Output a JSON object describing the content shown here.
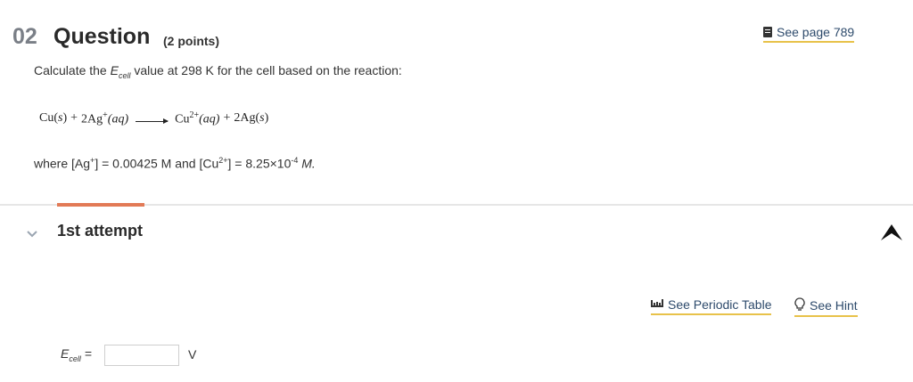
{
  "question": {
    "number": "02",
    "title": "Question",
    "points": "(2 points)",
    "see_page": "See page 789",
    "prompt_before": "Calculate the ",
    "prompt_e": "E",
    "prompt_sub": "cell",
    "prompt_after": " value at 298 K for the cell based on the reaction:"
  },
  "reaction": {
    "r1": "Cu(",
    "r1_state": "s",
    "r1_close": ")",
    "plus1": "+",
    "r2": "2Ag",
    "r2_sup": "+",
    "r2_state": "(aq)",
    "p1": "Cu",
    "p1_sup": "2+",
    "p1_state": "(aq)",
    "plus2": "+",
    "p2": "2Ag(",
    "p2_state": "s",
    "p2_close": ")"
  },
  "conditions": {
    "where_a": "where [Ag",
    "ag_sup": "+",
    "where_b": "] = 0.00425 M and [Cu",
    "cu_sup": "2+",
    "where_c": "] = 8.25×10",
    "exp_sup": "-4",
    "where_d": " M."
  },
  "attempt": {
    "label": "1st attempt",
    "periodic_table": "See Periodic Table",
    "hint": "See Hint",
    "ecell_e": "E",
    "ecell_sub": "cell",
    "ecell_eq": " =",
    "input_value": "",
    "unit": "V"
  },
  "colors": {
    "accent": "#e27a56",
    "link_underline": "#e8c24a",
    "link_text": "#2d4a6b"
  }
}
